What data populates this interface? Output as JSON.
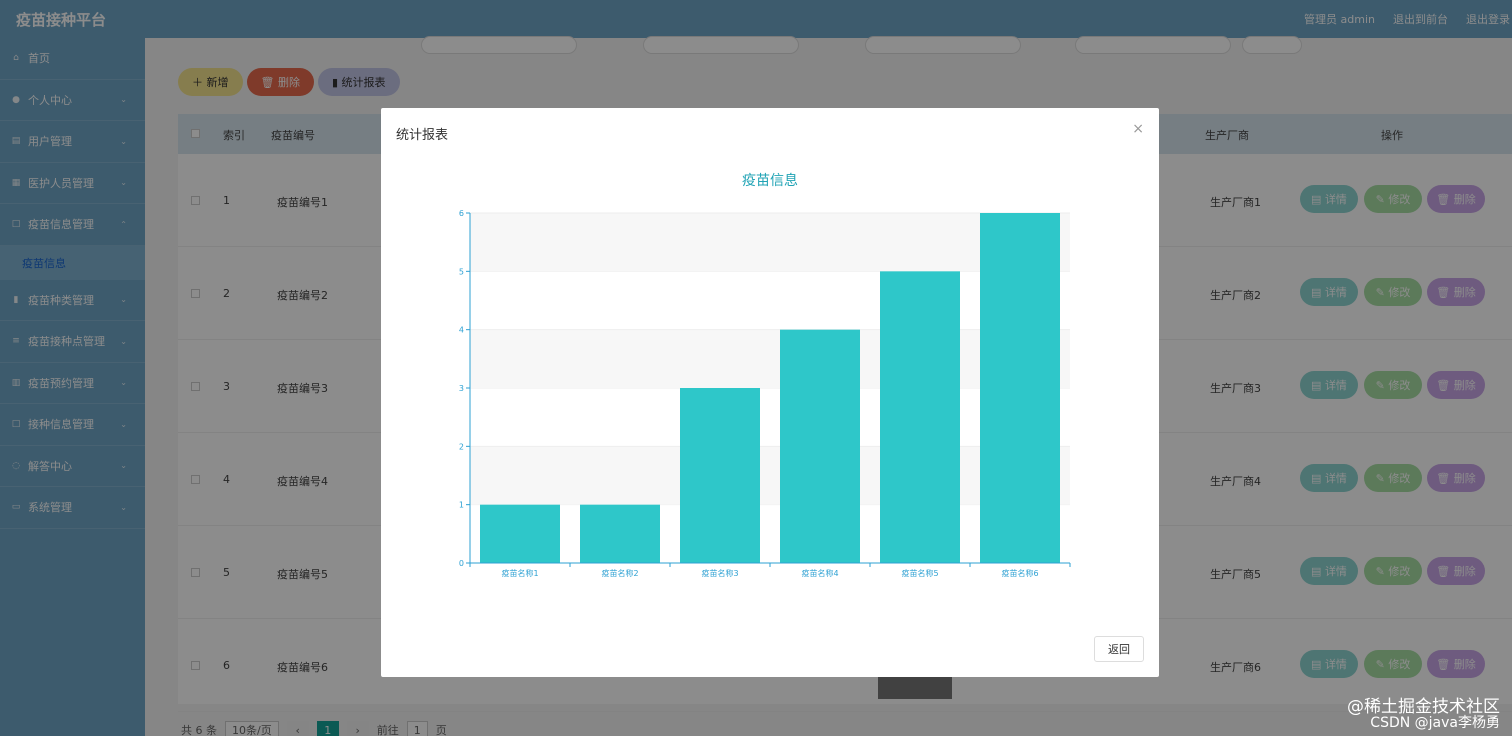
{
  "app": {
    "title": "疫苗接种平台"
  },
  "header": {
    "user": "管理员 admin",
    "to_front": "退出到前台",
    "logout": "退出登录"
  },
  "sidebar": {
    "items": [
      {
        "label": "首页",
        "icon": "home-icon"
      },
      {
        "label": "个人中心",
        "icon": "user-icon"
      },
      {
        "label": "用户管理",
        "icon": "users-icon"
      },
      {
        "label": "医护人员管理",
        "icon": "staff-icon"
      },
      {
        "label": "疫苗信息管理",
        "icon": "vaccine-icon"
      }
    ],
    "active_sub": "疫苗信息",
    "items2": [
      {
        "label": "疫苗种类管理",
        "icon": "chart-icon"
      },
      {
        "label": "疫苗接种点管理",
        "icon": "list-icon"
      },
      {
        "label": "疫苗预约管理",
        "icon": "calendar-icon"
      },
      {
        "label": "接种信息管理",
        "icon": "info-icon"
      },
      {
        "label": "解答中心",
        "icon": "chat-icon"
      },
      {
        "label": "系统管理",
        "icon": "settings-icon"
      }
    ]
  },
  "toolbar": {
    "add": "新增",
    "delete": "删除",
    "stats": "统计报表"
  },
  "table": {
    "headers": {
      "index": "索引",
      "code": "疫苗编号",
      "maker": "生产厂商",
      "ops": "操作"
    },
    "rows": [
      {
        "index": "1",
        "code": "疫苗编号1",
        "maker": "生产厂商1"
      },
      {
        "index": "2",
        "code": "疫苗编号2",
        "maker": "生产厂商2"
      },
      {
        "index": "3",
        "code": "疫苗编号3",
        "maker": "生产厂商3"
      },
      {
        "index": "4",
        "code": "疫苗编号4",
        "maker": "生产厂商4"
      },
      {
        "index": "5",
        "code": "疫苗编号5",
        "maker": "生产厂商5"
      },
      {
        "index": "6",
        "code": "疫苗编号6",
        "maker": "生产厂商6"
      }
    ],
    "ops": {
      "detail": "详情",
      "edit": "修改",
      "delete": "删除"
    }
  },
  "pager": {
    "total": "共 6 条",
    "size": "10条/页",
    "current": "1",
    "goto": "前往",
    "goto_value": "1",
    "page_unit": "页"
  },
  "modal": {
    "title": "统计报表",
    "close": "×",
    "back": "返回"
  },
  "chart_data": {
    "type": "bar",
    "title": "疫苗信息",
    "categories": [
      "疫苗名称1",
      "疫苗名称2",
      "疫苗名称3",
      "疫苗名称4",
      "疫苗名称5",
      "疫苗名称6"
    ],
    "values": [
      1,
      1,
      3,
      4,
      5,
      6
    ],
    "ylim": [
      0,
      6
    ],
    "yticks": [
      0,
      1,
      2,
      3,
      4,
      5,
      6
    ],
    "bar_color": "#2ec7c9",
    "axis_color": "#2ea1d3",
    "grid": true
  },
  "watermark": {
    "line1": "@稀土掘金技术社区",
    "line2": "CSDN @java李杨勇"
  }
}
